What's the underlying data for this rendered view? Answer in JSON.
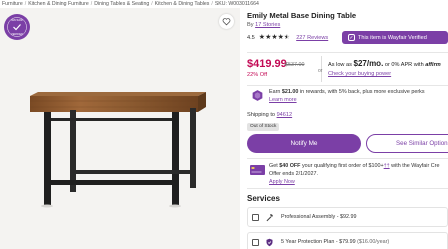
{
  "breadcrumb": [
    "Furniture",
    "Kitchen & Dining Furniture",
    "Dining Tables & Seating",
    "Kitchen & Dining Tables",
    "SKU: W003011664"
  ],
  "product": {
    "title": "Emily Metal Base Dining Table",
    "by_prefix": "By",
    "brand": "17 Stories",
    "rating": "4.5",
    "stars": 4.5,
    "reviews": "227 Reviews",
    "verified_label": "This item is Wayfair Verified"
  },
  "badge": {
    "line1": "WAYFAIR",
    "line2": "VERIFIED"
  },
  "pricing": {
    "price": "$419.99",
    "old_price": "$537.00",
    "off": "22% Off",
    "or": "or",
    "as_low_prefix": "As low as",
    "as_low_amount": "$27/mo.",
    "as_low_suffix": "or 0% APR with",
    "affirm": "affirm",
    "check_power": "Check your buying power"
  },
  "rewards": {
    "prefix": "Earn",
    "amount": "$21.00",
    "text": "in rewards, with 5% back",
    "suffix": ", plus more exclusive perks",
    "learn_more": "Learn more"
  },
  "shipping": {
    "prefix": "Shipping to",
    "zip": "94612",
    "status": "Out of Stock"
  },
  "actions": {
    "notify": "Notify Me",
    "similar": "See Similar Options"
  },
  "credit": {
    "line1_a": "Get",
    "line1_b": "$40 OFF",
    "line1_c": "your qualifying first order of $100+",
    "line1_d": "with the Wayfair Cre",
    "line2": "Offer ends 2/1/2027.",
    "apply": "Apply Now"
  },
  "services": {
    "heading": "Services",
    "items": [
      {
        "label": "Professional Assembly - $92.99",
        "extra": ""
      },
      {
        "label": "5 Year Protection Plan - $79.99",
        "extra": "($16.00/year)"
      }
    ]
  },
  "colors": {
    "accent": "#7b3fa6",
    "price": "#c30a55"
  }
}
